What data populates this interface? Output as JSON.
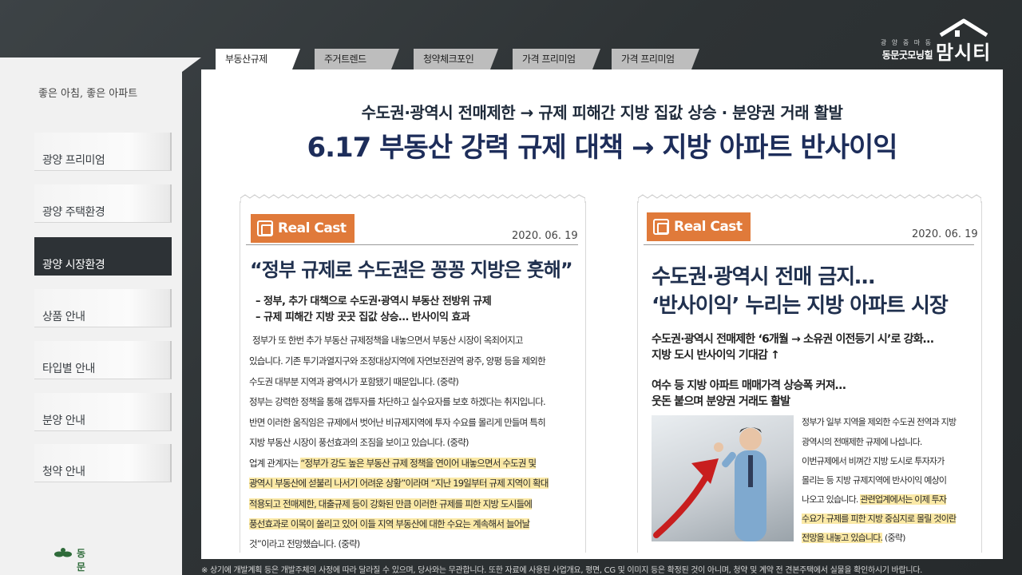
{
  "brand": {
    "sub_line1": "광 양 중 마 동",
    "sub_line2": "동문굿모닝힐",
    "name": "맘시티",
    "colors": {
      "text": "#ffffff"
    }
  },
  "sidebar": {
    "tagline": "좋은 아침, 좋은 아파트",
    "items": [
      {
        "label": "광양 프리미엄"
      },
      {
        "label": "광양 주택환경"
      },
      {
        "label": "광양 시장환경"
      },
      {
        "label": "상품 안내"
      },
      {
        "label": "타입별 안내"
      },
      {
        "label": "분양 안내"
      },
      {
        "label": "청약 안내"
      }
    ],
    "active_index": 2,
    "logo_text": "동문건설"
  },
  "tabs": [
    {
      "label": "부동산규제"
    },
    {
      "label": "주거트렌드"
    },
    {
      "label": "청약체크포인트"
    },
    {
      "label": "가격 프리미엄①"
    },
    {
      "label": "가격 프리미엄②"
    }
  ],
  "headline": {
    "sub": "수도권·광역시 전매제한 → 규제 피해간 지방 집값 상승 · 분양권 거래 활발",
    "main": "6.17 부동산 강력 규제 대책 → 지방 아파트 반사이익"
  },
  "article_left": {
    "badge": "Real Cast",
    "date": "2020. 06. 19",
    "title": "“정부 규제로 수도권은 꽁꽁 지방은 훗해”",
    "subs": [
      "– 정부, 추가 대책으로 수도권·광역시 부동산 전방위 규제",
      "– 규제 피해간 지방 곳곳 집값 상승… 반사이익 효과"
    ],
    "body": [
      "정부가 또 한번 추가 부동산 규제정책을 내놓으면서 부동산 시장이 옥죄어지고",
      "있습니다. 기존 투기과열지구와 조정대상지역에 자연보전권역 광주, 양평 등을 제외한",
      "수도권 대부분 지역과 광역시가 포함됐기 때문입니다. (중략)",
      "정부는 강력한 정책을 통해 갭투자를 차단하고 실수요자를 보호 하겠다는 취지입니다.",
      "반면 이러한 움직임은 규제에서 벗어난 비규제지역에 투자 수요를 몰리게 만들며 특히",
      "지방 부동산 시장이 풍선효과의 조짐을 보이고 있습니다. (중략)"
    ],
    "quote_prefix": "업계 관계자는 ",
    "quote_lines": [
      "“정부가 강도 높은 부동산 규제 정책을 연이어 내놓으면서 수도권 및",
      "광역시 부동산에 섣불리 나서기 어려운 상황”이라며 “지난 19일부터 규제 지역이 확대",
      "적용되고 전매제한, 대출규제 등이 강화된 만큼 이러한 규제를 피한 지방 도시들에",
      "풍선효과로 이목이 쏠리고 있어 이들 지역 부동산에 대한 수요는 계속해서 늘어날"
    ],
    "closing": "것”이라고 전망했습니다. (중략)"
  },
  "article_right": {
    "badge": "Real Cast",
    "date": "2020. 06. 19",
    "title_lines": [
      "수도권·광역시 전매 금지…",
      "‘반사이익’ 누리는 지방 아파트 시장"
    ],
    "subs_a": [
      "수도권·광역시 전매제한 ‘6개월 → 소유권 이전등기 시’로 강화…",
      "지방 도시 반사이익 기대감 ↑"
    ],
    "subs_b": [
      "여수 등 지방 아파트 매매가격 상승폭 커져…",
      "웃돈 붙으며 분양권 거래도 활발"
    ],
    "body": [
      "정부가 일부 지역을 제외한 수도권 전역과 지방",
      "광역시의 전매제한 규제에 나섭니다.",
      "이번규제에서 비껴간 지방 도시로 투자자가",
      "몰리는 등 지방 규제지역에 반사이익 예상이",
      "나오고 있습니다. "
    ],
    "highlight": [
      "관련업계에서는 이제 투자",
      "수요가 규제를 피한 지방 중심지로 몰릴 것이란",
      "전망을 내놓고 있습니다."
    ],
    "closing": "(중략)"
  },
  "footer": "※ 상기에 개발계획 등은 개발주체의 사정에 따라 달라질 수 있으며, 당사와는 무관합니다. 또한 자료에 사용된 사업개요, 평면, CG 및 이미지 등은 확정된 것이 아니며, 청약 및 계약 전 견본주택에서 실물을 확인하시기 바랍니다.",
  "colors": {
    "accent_badge": "#e07a3a",
    "headline": "#1d2d5a",
    "highlight": "#fbe9a6",
    "active_menu": "#2d3236"
  }
}
